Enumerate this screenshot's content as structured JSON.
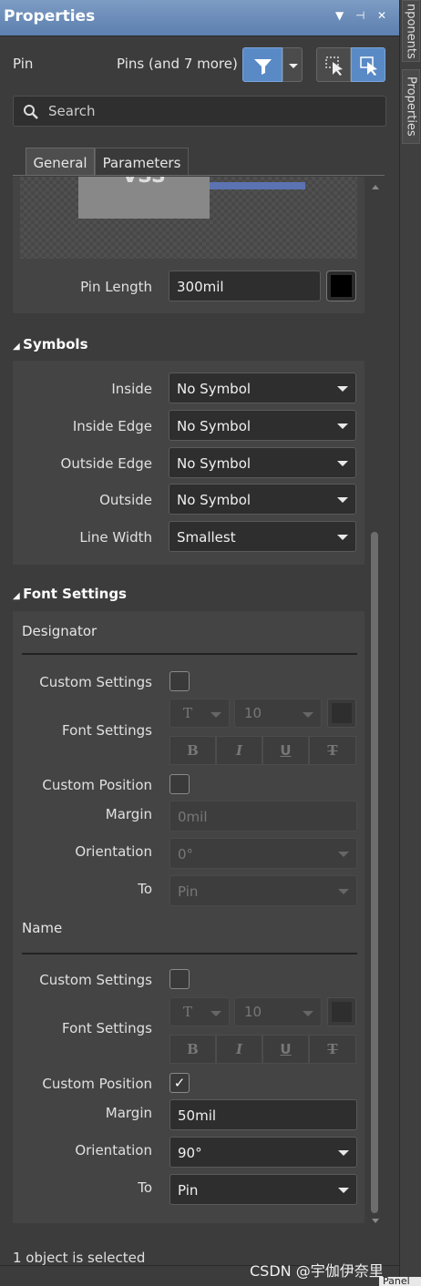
{
  "window": {
    "title": "Properties",
    "menu_icon": "chevron-down-icon",
    "pin_icon": "pin-icon",
    "close_icon": "close-icon"
  },
  "side_tabs": {
    "components": "nponents",
    "properties": "Properties"
  },
  "header": {
    "object_type": "Pin",
    "selection": "Pins (and 7 more)"
  },
  "search": {
    "placeholder": "Search"
  },
  "tabs": [
    {
      "label": "General"
    },
    {
      "label": "Parameters"
    }
  ],
  "preview": {
    "text": "VSS"
  },
  "pin_length": {
    "label": "Pin Length",
    "value": "300mil",
    "color": "#000000"
  },
  "symbols": {
    "title": "Symbols",
    "rows": [
      {
        "label": "Inside",
        "value": "No Symbol"
      },
      {
        "label": "Inside Edge",
        "value": "No Symbol"
      },
      {
        "label": "Outside Edge",
        "value": "No Symbol"
      },
      {
        "label": "Outside",
        "value": "No Symbol"
      },
      {
        "label": "Line Width",
        "value": "Smallest"
      }
    ]
  },
  "font_settings": {
    "title": "Font Settings",
    "designator": {
      "title": "Designator",
      "custom_settings_label": "Custom Settings",
      "custom_settings_checked": false,
      "font_settings_label": "Font Settings",
      "font_glyph": "T",
      "font_size": "10",
      "bold": "B",
      "italic": "I",
      "underline": "U",
      "strike": "T",
      "custom_position_label": "Custom Position",
      "custom_position_checked": false,
      "margin_label": "Margin",
      "margin_value": "0mil",
      "orientation_label": "Orientation",
      "orientation_value": "0°",
      "to_label": "To",
      "to_value": "Pin"
    },
    "name": {
      "title": "Name",
      "custom_settings_label": "Custom Settings",
      "custom_settings_checked": false,
      "font_settings_label": "Font Settings",
      "font_glyph": "T",
      "font_size": "10",
      "bold": "B",
      "italic": "I",
      "underline": "U",
      "strike": "T",
      "custom_position_label": "Custom Position",
      "custom_position_checked": true,
      "check_mark": "✓",
      "margin_label": "Margin",
      "margin_value": "50mil",
      "orientation_label": "Orientation",
      "orientation_value": "90°",
      "to_label": "To",
      "to_value": "Pin"
    }
  },
  "status": {
    "text": "1 object is selected"
  },
  "watermark": {
    "text": "CSDN @宇伽伊奈里"
  },
  "bottom_tab": {
    "text": "Panel"
  },
  "colors": {
    "accent": "#5a8ac6",
    "titlebar": "#6b8cbc"
  }
}
